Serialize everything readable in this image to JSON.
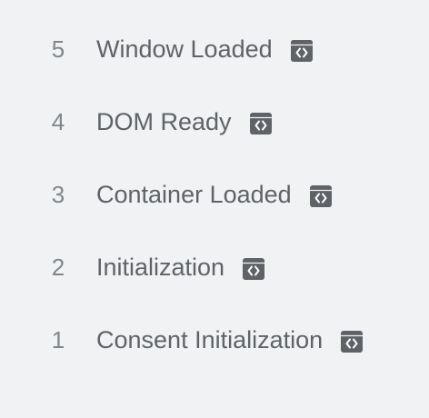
{
  "events": [
    {
      "number": "5",
      "label": "Window Loaded",
      "icon": "code-tag-icon"
    },
    {
      "number": "4",
      "label": "DOM Ready",
      "icon": "code-tag-icon"
    },
    {
      "number": "3",
      "label": "Container Loaded",
      "icon": "code-tag-icon"
    },
    {
      "number": "2",
      "label": "Initialization",
      "icon": "code-tag-icon"
    },
    {
      "number": "1",
      "label": "Consent Initialization",
      "icon": "code-tag-icon"
    }
  ],
  "colors": {
    "background": "#f1f2f4",
    "number": "#80868b",
    "label": "#5f6368",
    "icon": "#5f6368"
  }
}
